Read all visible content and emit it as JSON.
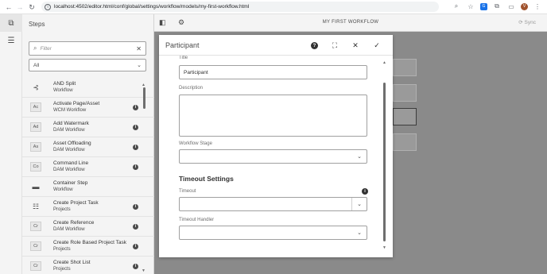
{
  "browser": {
    "url": "localhost:4502/editor.html/conf/global/settings/workflow/models/my-first-workflow.html",
    "profile_initial": "V"
  },
  "steps_panel": {
    "title": "Steps",
    "filter_placeholder": "Filter",
    "category_value": "All",
    "items": [
      {
        "name": "AND Split",
        "category": "Workflow",
        "icon": "split-icon",
        "badge": "",
        "info": false
      },
      {
        "name": "Activate Page/Asset",
        "category": "WCM Workflow",
        "icon": "",
        "badge": "Ac",
        "info": true
      },
      {
        "name": "Add Watermark",
        "category": "DAM Workflow",
        "icon": "",
        "badge": "Ad",
        "info": true
      },
      {
        "name": "Asset Offloading",
        "category": "DAM Workflow",
        "icon": "",
        "badge": "As",
        "info": true
      },
      {
        "name": "Command Line",
        "category": "DAM Workflow",
        "icon": "",
        "badge": "Co",
        "info": true
      },
      {
        "name": "Container Step",
        "category": "Workflow",
        "icon": "container-icon",
        "badge": "",
        "info": false
      },
      {
        "name": "Create Project Task",
        "category": "Projects",
        "icon": "task-icon",
        "badge": "",
        "info": true
      },
      {
        "name": "Create Reference",
        "category": "DAM Workflow",
        "icon": "",
        "badge": "Cr",
        "info": true
      },
      {
        "name": "Create Role Based Project Task",
        "category": "Projects",
        "icon": "",
        "badge": "Cr",
        "info": true
      },
      {
        "name": "Create Shot List",
        "category": "Projects",
        "icon": "",
        "badge": "Cr",
        "info": true
      }
    ]
  },
  "editor": {
    "workflow_title": "MY FIRST WORKFLOW",
    "sync_label": "Sync"
  },
  "dialog": {
    "title": "Participant",
    "title_label": "Title",
    "title_value": "Participant",
    "description_label": "Description",
    "description_value": "",
    "workflow_stage_label": "Workflow Stage",
    "workflow_stage_value": "",
    "timeout_section": "Timeout Settings",
    "timeout_label": "Timeout",
    "timeout_value": "",
    "timeout_handler_label": "Timeout Handler",
    "timeout_handler_value": ""
  }
}
